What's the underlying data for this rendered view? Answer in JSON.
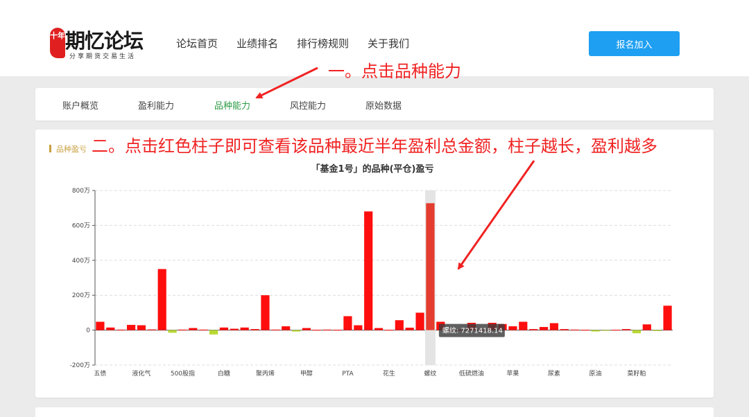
{
  "brand": {
    "seal": "十年",
    "name": "期忆论坛",
    "slogan": "分享期货交易生活"
  },
  "nav": [
    "论坛首页",
    "业绩排名",
    "排行榜规则",
    "关于我们"
  ],
  "join_button": "报名加入",
  "tabs": [
    {
      "label": "账户概览",
      "active": false
    },
    {
      "label": "盈利能力",
      "active": false
    },
    {
      "label": "品种能力",
      "active": true
    },
    {
      "label": "风控能力",
      "active": false
    },
    {
      "label": "原始数据",
      "active": false
    }
  ],
  "annotations": {
    "step1": "一。点击品种能力",
    "step2": "二。点击红色柱子即可查看该品种最近半年盈利总金额，柱子越长，盈利越多"
  },
  "section_title": "品种盈亏",
  "colors": {
    "profit": "#ff0e0e",
    "loss": "#b8d832",
    "highlight_bar": "#e43c2e",
    "accent": "#1e9ff2",
    "annotation": "#f02222"
  },
  "chart_data": {
    "type": "bar",
    "title": "「基金1号」的品种(平仓)盈亏",
    "ylim": [
      -200,
      800
    ],
    "y_ticks": [
      "800万",
      "600万",
      "400万",
      "200万",
      "0",
      "-200万"
    ],
    "y_tick_values": [
      800,
      600,
      400,
      200,
      0,
      -200
    ],
    "y_unit": "万",
    "grid": true,
    "x_labels": [
      {
        "index": 0,
        "label": "五债"
      },
      {
        "index": 4,
        "label": "液化气"
      },
      {
        "index": 8,
        "label": "500股指"
      },
      {
        "index": 12,
        "label": "白糖"
      },
      {
        "index": 16,
        "label": "聚丙烯"
      },
      {
        "index": 20,
        "label": "甲醇"
      },
      {
        "index": 24,
        "label": "PTA"
      },
      {
        "index": 28,
        "label": "花生"
      },
      {
        "index": 32,
        "label": "螺纹"
      },
      {
        "index": 36,
        "label": "低硫燃油"
      },
      {
        "index": 40,
        "label": "苹果"
      },
      {
        "index": 44,
        "label": "尿素"
      },
      {
        "index": 48,
        "label": "原油"
      },
      {
        "index": 52,
        "label": "菜籽粕"
      }
    ],
    "values": [
      48,
      15,
      3,
      30,
      28,
      4,
      350,
      -15,
      3,
      12,
      3,
      -25,
      15,
      8,
      15,
      6,
      200,
      3,
      22,
      -8,
      12,
      2,
      3,
      2,
      80,
      28,
      680,
      12,
      2,
      57,
      14,
      100,
      727.14,
      48,
      3,
      3,
      42,
      3,
      42,
      35,
      22,
      48,
      6,
      18,
      40,
      6,
      3,
      2,
      -8,
      -4,
      2,
      6,
      -18,
      33,
      -5,
      140
    ],
    "highlight_index": 32,
    "tooltip": "螺纹: 7271418.14"
  }
}
